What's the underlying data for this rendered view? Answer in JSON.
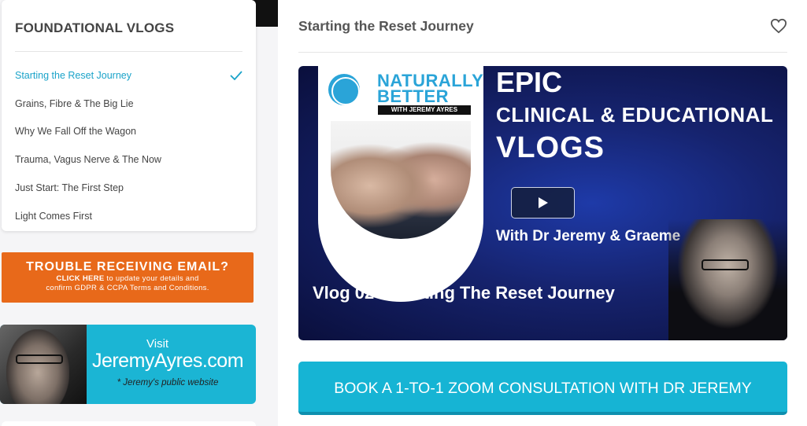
{
  "sidebar": {
    "title": "FOUNDATIONAL VLOGS",
    "items": [
      {
        "label": "Starting the Reset Journey",
        "active": true
      },
      {
        "label": "Grains, Fibre & The Big Lie"
      },
      {
        "label": "Why We Fall Off the Wagon"
      },
      {
        "label": "Trauma, Vagus Nerve & The Now"
      },
      {
        "label": "Just Start: The First Step"
      },
      {
        "label": "Light Comes First"
      }
    ],
    "active_color": "#1aa3c9"
  },
  "email_banner": {
    "headline": "TROUBLE RECEIVING EMAIL?",
    "click_here": "CLICK HERE",
    "line1_rest": " to update your details and",
    "line2": "confirm GDPR & CCPA Terms and Conditions.",
    "color": "#e8691a"
  },
  "site_banner": {
    "visit": "Visit",
    "site": "JeremyAyres.com",
    "note": "* Jeremy's public website",
    "color": "#1bb5d4"
  },
  "main": {
    "title": "Starting the Reset Journey",
    "favorite_icon": "heart-icon",
    "video": {
      "logo_line1": "NATURALLY",
      "logo_line2": "BETTER",
      "logo_strip": "WITH JEREMY AYRES",
      "heading1": "EPIC",
      "heading2": "CLINICAL & EDUCATIONAL",
      "heading3": "VLOGS",
      "with_text": "With Dr Jeremy & Graeme",
      "vlog_title": "Vlog 02 - Starting The Reset Journey",
      "play_icon": "play-icon"
    },
    "book_button": "BOOK A 1-TO-1 ZOOM CONSULTATION WITH DR JEREMY",
    "accent_color": "#16b4d4"
  }
}
